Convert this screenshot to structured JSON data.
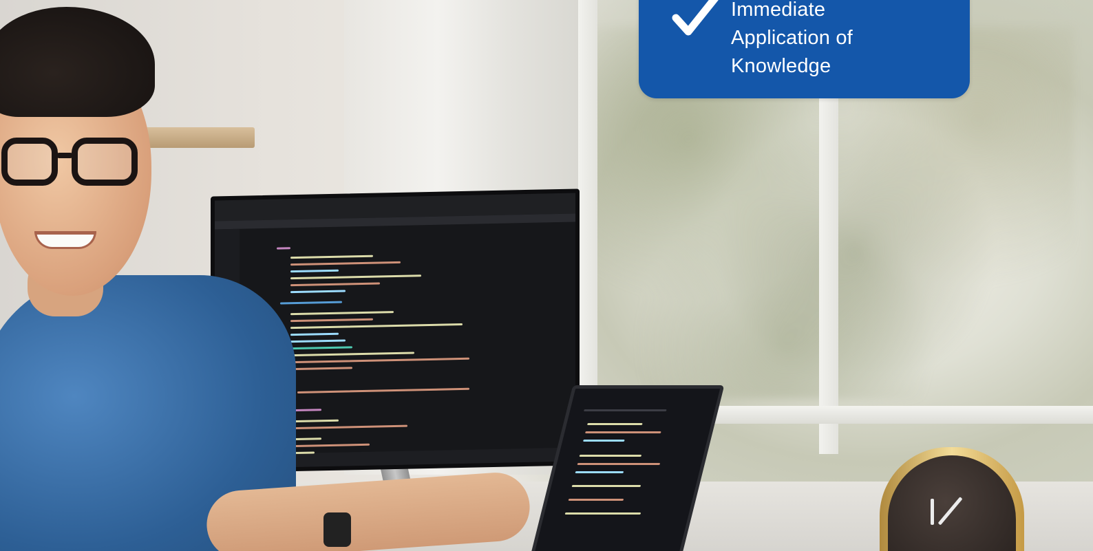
{
  "callout": {
    "lines": [
      "Immediate",
      "Application of",
      "Knowledge"
    ],
    "icon": "check-icon",
    "background_color": "#1457aa",
    "text_color": "#ffffff"
  }
}
